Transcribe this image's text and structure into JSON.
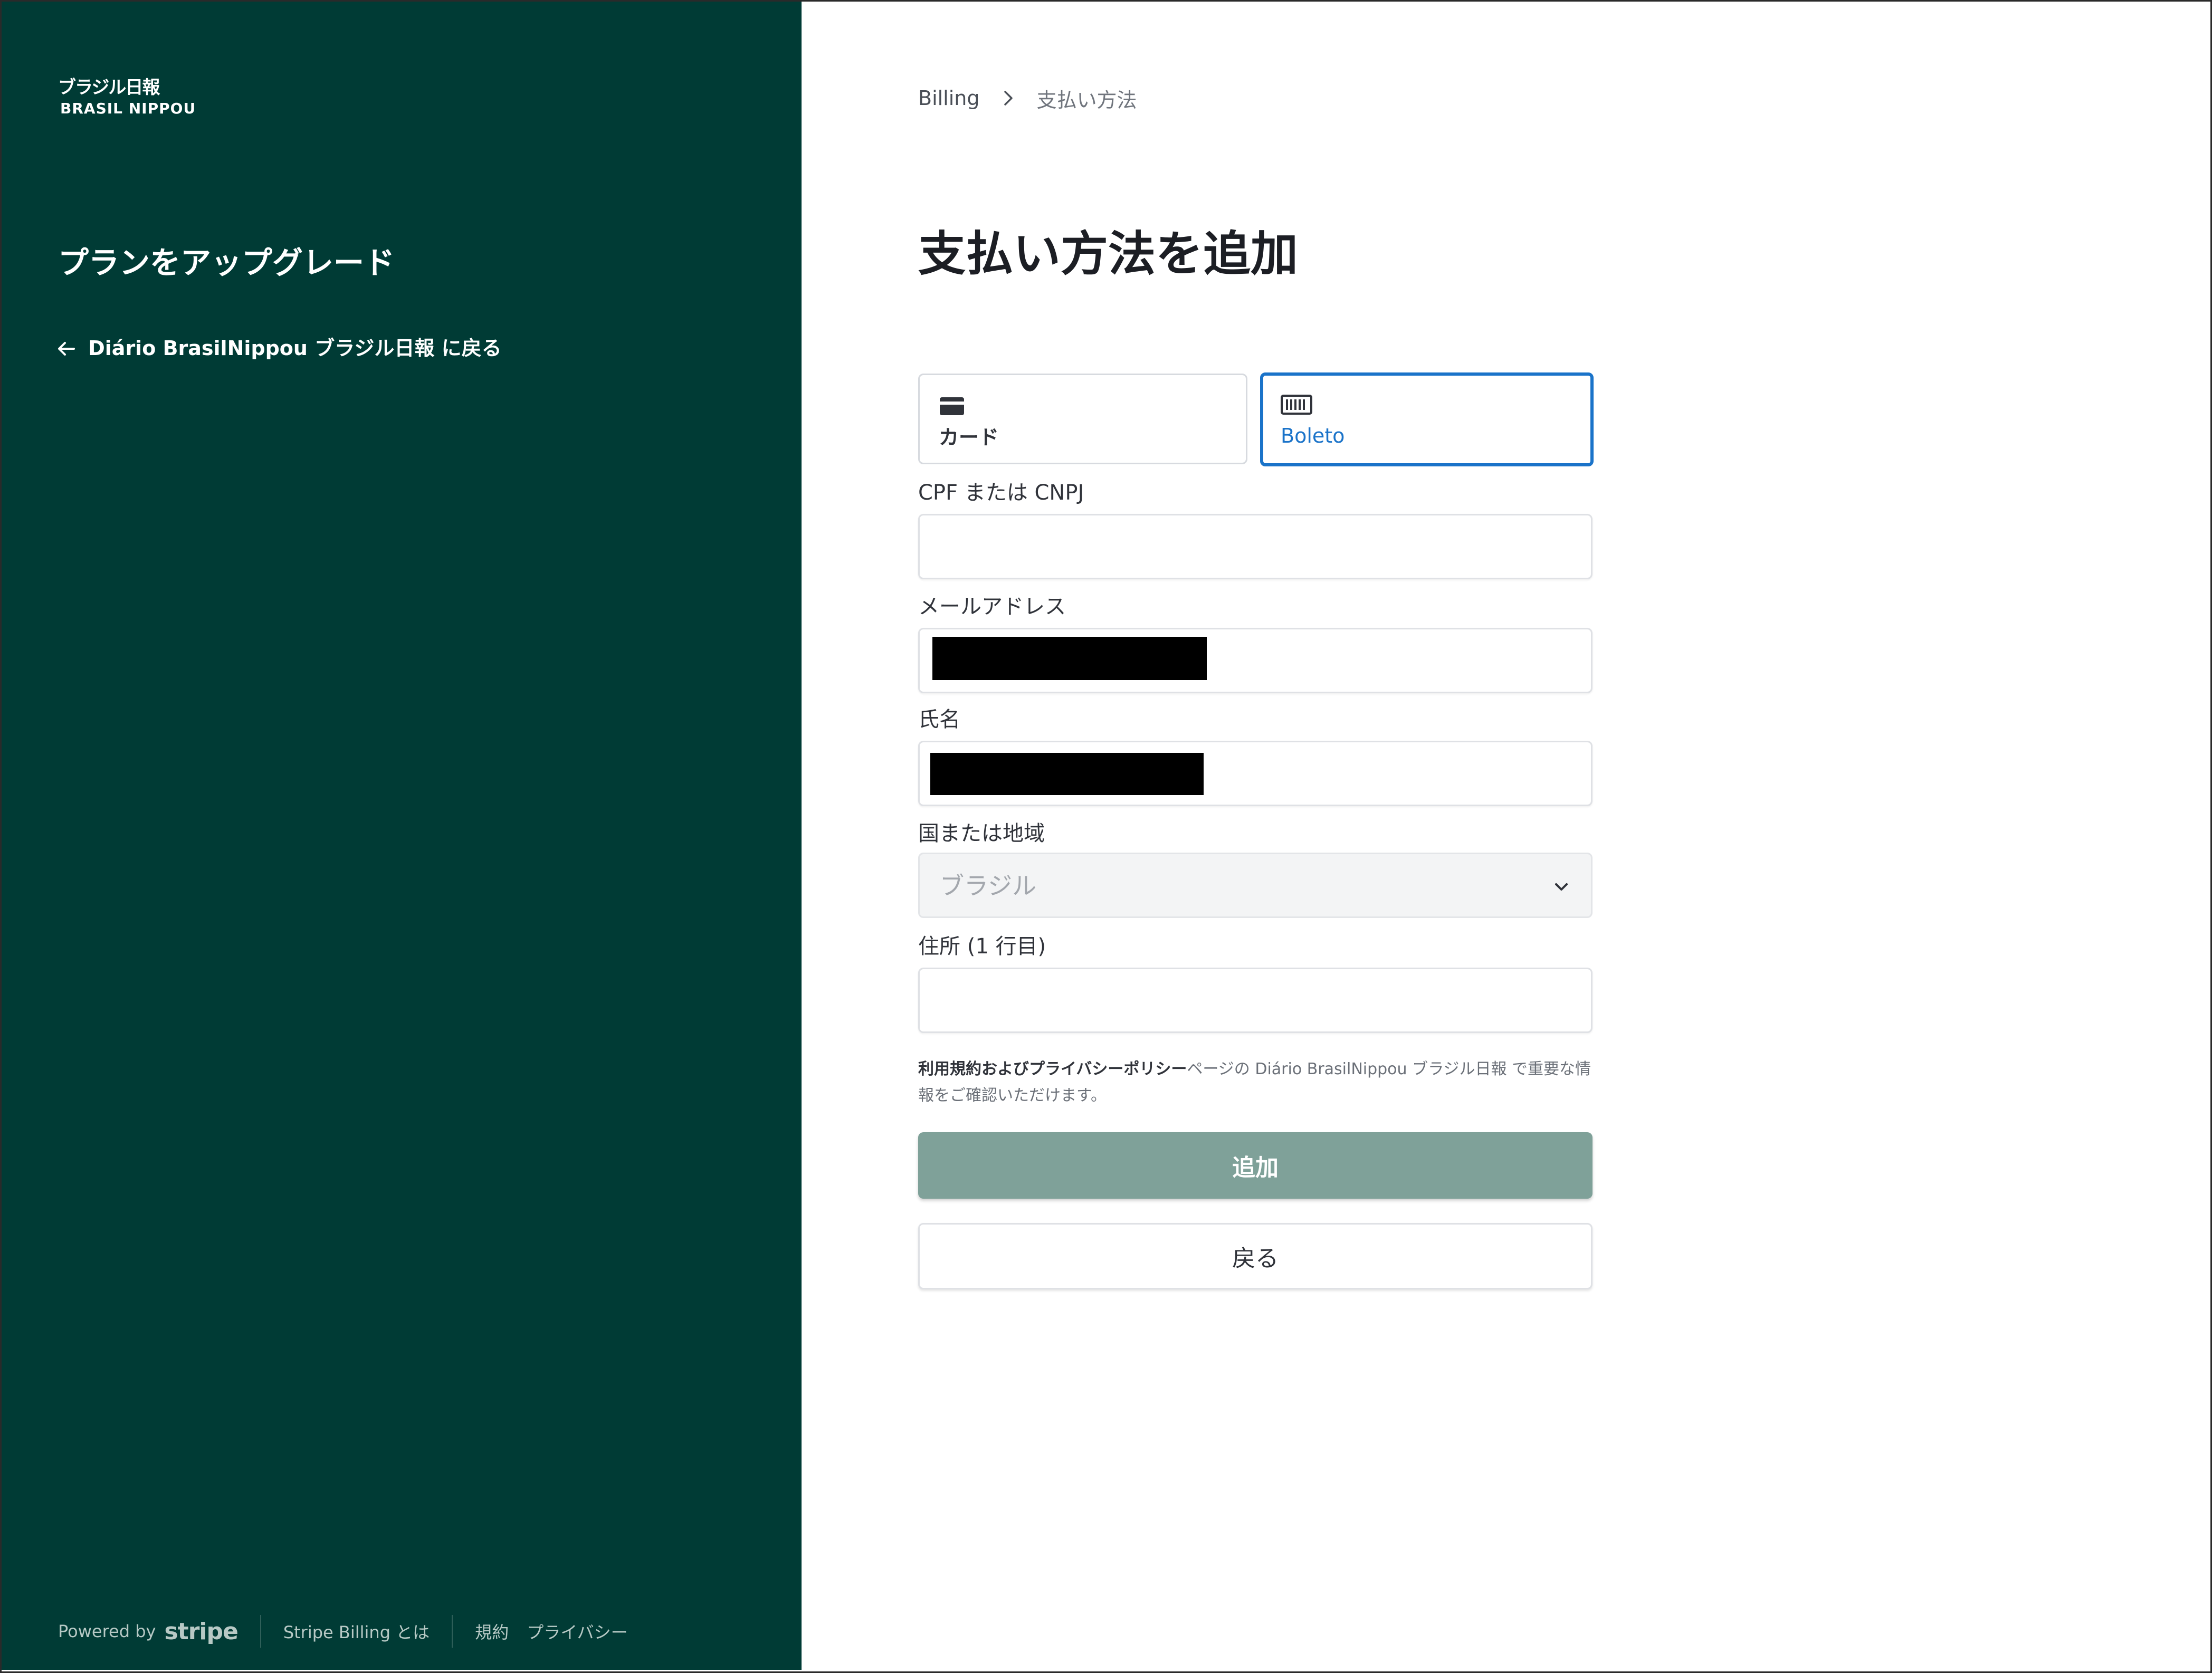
{
  "sidebar": {
    "logo_jp": "ブラジル日報",
    "logo_en": "BRASIL NIPPOU",
    "title": "プランをアップグレード",
    "back_link": "Diário BrasilNippou ブラジル日報 に戻る",
    "background_color": "#003b35",
    "footer": {
      "powered_by": "Powered by",
      "stripe": "stripe",
      "what_is_billing": "Stripe Billing とは",
      "terms": "規約",
      "privacy": "プライバシー"
    }
  },
  "breadcrumb": {
    "root": "Billing",
    "current": "支払い方法"
  },
  "main": {
    "title": "支払い方法を追加",
    "tabs": [
      {
        "label": "カード",
        "icon": "credit-card-icon",
        "selected": false
      },
      {
        "label": "Boleto",
        "icon": "barcode-icon",
        "selected": true
      }
    ],
    "accent_color": "#1a73c9",
    "fields": {
      "tax_id_label": "CPF または CNPJ",
      "email_label": "メールアドレス",
      "name_label": "氏名",
      "country_label": "国または地域",
      "country_value": "ブラジル",
      "address_label": "住所 (1 行目)"
    },
    "terms": {
      "link": "利用規約およびプライバシーポリシー",
      "text": "ページの Diário BrasilNippou ブラジル日報 で重要な情報をご確認いただけます。"
    },
    "add_button": "追加",
    "add_button_color": "#7fa199",
    "back_button": "戻る"
  }
}
